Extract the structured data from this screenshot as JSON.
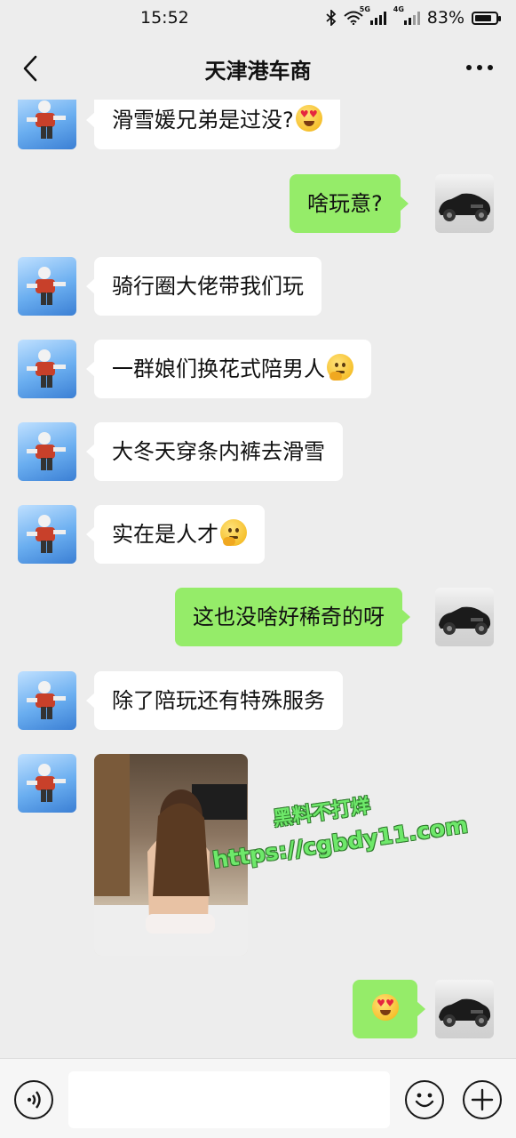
{
  "status_bar": {
    "time": "15:52",
    "network_top_label": "5G",
    "network_second_label": "4G",
    "battery_percent": "83%",
    "battery_level": 0.83
  },
  "nav": {
    "title": "天津港车商"
  },
  "messages": [
    {
      "side": "in",
      "text": "滑雪媛兄弟是过没?",
      "emoji": "heart-eyes-emoji"
    },
    {
      "side": "out",
      "text": "啥玩意?"
    },
    {
      "side": "in",
      "text": "骑行圈大佬带我们玩"
    },
    {
      "side": "in",
      "text": "一群娘们换花式陪男人",
      "emoji": "thinking-emoji"
    },
    {
      "side": "in",
      "text": "大冬天穿条内裤去滑雪"
    },
    {
      "side": "in",
      "text": "实在是人才",
      "emoji": "thinking-emoji"
    },
    {
      "side": "out",
      "text": "这也没啥好稀奇的呀"
    },
    {
      "side": "in",
      "text": "除了陪玩还有特殊服务"
    },
    {
      "side": "in",
      "type": "image"
    },
    {
      "side": "out",
      "text": "",
      "emoji": "heart-eyes-emoji"
    }
  ],
  "watermark": {
    "line1": "黑料不打烊",
    "line2": "https://cgbdy11.com"
  },
  "input_bar": {
    "voice_icon": "voice-icon",
    "emoji_icon": "emoji-icon",
    "plus_icon": "plus-icon"
  },
  "colors": {
    "background": "#ededed",
    "bubble_in": "#ffffff",
    "bubble_out": "#95ec69",
    "watermark": "#6ee86a"
  }
}
